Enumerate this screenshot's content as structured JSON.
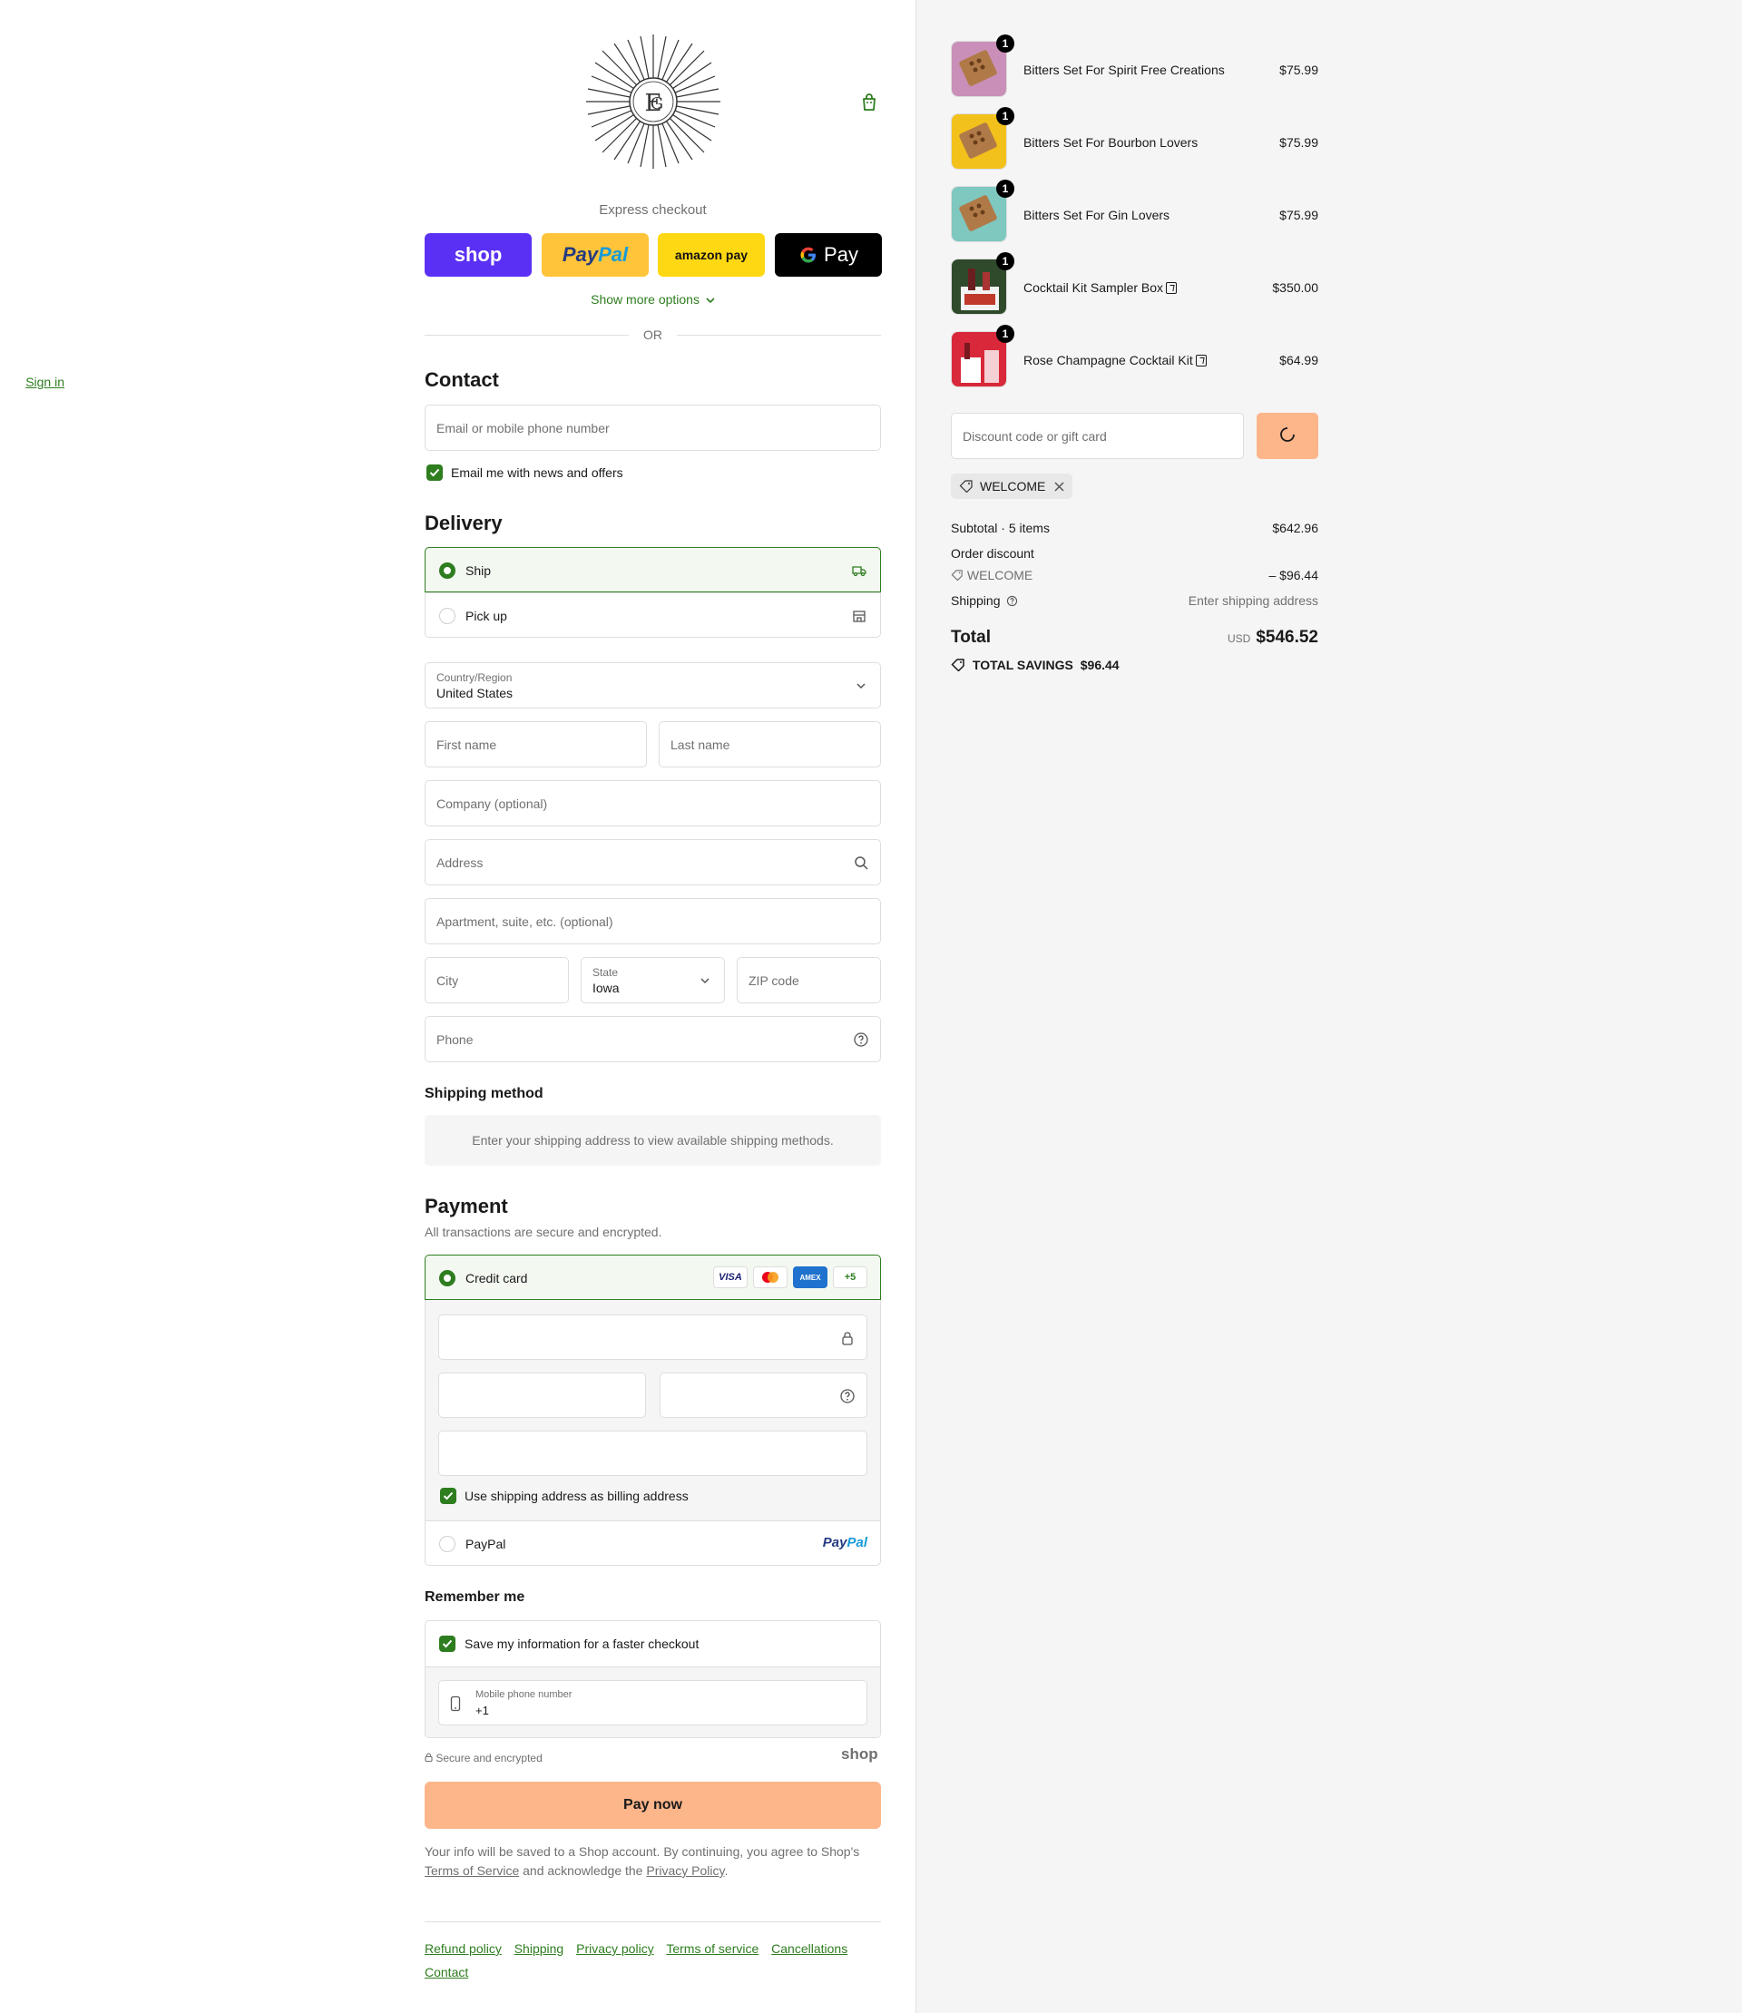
{
  "express": {
    "title": "Express checkout",
    "shop_label": "shop",
    "paypal_label_a": "Pay",
    "paypal_label_b": "Pal",
    "amazon_label": "amazon pay",
    "gpay_label": "Pay",
    "show_more": "Show more options",
    "or": "OR"
  },
  "contact": {
    "heading": "Contact",
    "sign_in": "Sign in",
    "email_placeholder": "Email or mobile phone number",
    "news_label": "Email me with news and offers"
  },
  "delivery": {
    "heading": "Delivery",
    "options": [
      {
        "label": "Ship",
        "selected": true
      },
      {
        "label": "Pick up",
        "selected": false
      }
    ],
    "country_label": "Country/Region",
    "country_value": "United States",
    "first_name": "First name",
    "last_name": "Last name",
    "company": "Company (optional)",
    "address": "Address",
    "apartment": "Apartment, suite, etc. (optional)",
    "city": "City",
    "state_label": "State",
    "state_value": "Iowa",
    "zip": "ZIP code",
    "phone": "Phone"
  },
  "shipping_method": {
    "heading": "Shipping method",
    "info": "Enter your shipping address to view available shipping methods."
  },
  "payment": {
    "heading": "Payment",
    "note": "All transactions are secure and encrypted.",
    "credit_card_label": "Credit card",
    "badges": [
      "VISA",
      "",
      "AMEX",
      "+5"
    ],
    "billing_label": "Use shipping address as billing address",
    "paypal_label": "PayPal",
    "paypal_logo_a": "Pay",
    "paypal_logo_b": "Pal"
  },
  "remember": {
    "heading": "Remember me",
    "save_label": "Save my information for a faster checkout",
    "phone_label": "Mobile phone number",
    "phone_value": "+1"
  },
  "footer": {
    "secure": "Secure and encrypted",
    "shop_word": "shop",
    "pay_now": "Pay now",
    "legal_1": "Your info will be saved to a Shop account. By continuing, you agree to Shop's",
    "terms": "Terms of Service",
    "legal_2": "and acknowledge the",
    "privacy": "Privacy Policy",
    "legal_3": ".",
    "links": [
      "Refund policy",
      "Shipping",
      "Privacy policy",
      "Terms of service",
      "Cancellations",
      "Contact"
    ]
  },
  "cart": {
    "items": [
      {
        "name": "Bitters Set For Spirit Free Creations",
        "price": "$75.99",
        "qty": "1",
        "gift": false,
        "color": "#c98fb8"
      },
      {
        "name": "Bitters Set For Bourbon Lovers",
        "price": "$75.99",
        "qty": "1",
        "gift": false,
        "color": "#f3c11b"
      },
      {
        "name": "Bitters Set For Gin Lovers",
        "price": "$75.99",
        "qty": "1",
        "gift": false,
        "color": "#7ec8c0"
      },
      {
        "name": "Cocktail Kit Sampler Box",
        "price": "$350.00",
        "qty": "1",
        "gift": true,
        "color": "#2f4a2b"
      },
      {
        "name": "Rose Champagne Cocktail Kit",
        "price": "$64.99",
        "qty": "1",
        "gift": true,
        "color": "#d8283a"
      }
    ],
    "discount_placeholder": "Discount code or gift card",
    "applied_code": "WELCOME",
    "subtotal_label": "Subtotal · 5 items",
    "subtotal_value": "$642.96",
    "order_discount_label": "Order discount",
    "discount_code": "WELCOME",
    "discount_value": "– $96.44",
    "shipping_label": "Shipping",
    "shipping_value": "Enter shipping address",
    "total_label": "Total",
    "currency": "USD",
    "total_value": "$546.52",
    "savings_label": "TOTAL SAVINGS",
    "savings_value": "$96.44"
  },
  "colors": {
    "accent": "#2e7d1f",
    "pay_button": "#fdb58a",
    "shop_purple": "#5a31f4"
  }
}
